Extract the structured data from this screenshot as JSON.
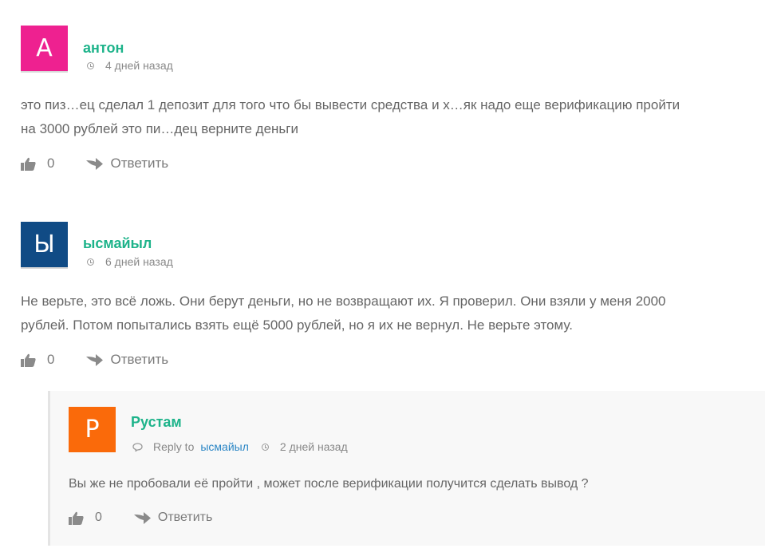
{
  "comments": [
    {
      "avatar_letter": "А",
      "avatar_color": "#ee2190",
      "author": "антон",
      "time": "4 дней назад",
      "text_lines": [
        "это пиз…ец сделал 1 депозит для того что бы вывести средства и х…як надо еще верификацию пройти",
        "на 3000 рублей это пи…дец верните деньги"
      ],
      "likes": "0",
      "reply_label": "Ответить"
    },
    {
      "avatar_letter": "Ы",
      "avatar_color": "#104b85",
      "author": "ысмайыл",
      "time": "6 дней назад",
      "text_lines": [
        "Не верьте, это всё ложь. Они берут деньги, но не возвращают их. Я проверил. Они взяли у меня 2000",
        "рублей. Потом попытались взять ещё 5000 рублей, но я их не вернул. Не верьте этому."
      ],
      "likes": "0",
      "reply_label": "Ответить"
    }
  ],
  "reply": {
    "avatar_letter": "Р",
    "avatar_color": "#fa6a0a",
    "author": "Рустам",
    "reply_to_label": "Reply to",
    "reply_to_user": "ысмайыл",
    "time": "2 дней назад",
    "text": "Вы же не пробовали её пройти , может после верификации получится сделать вывод ?",
    "likes": "0",
    "reply_label": "Ответить"
  },
  "colors": {
    "author": "#1db38a",
    "link": "#2b86c5",
    "text": "#666666"
  },
  "icons": [
    "clock-icon",
    "thumbs-up-icon",
    "reply-arrow-icon",
    "speech-bubble-icon"
  ]
}
